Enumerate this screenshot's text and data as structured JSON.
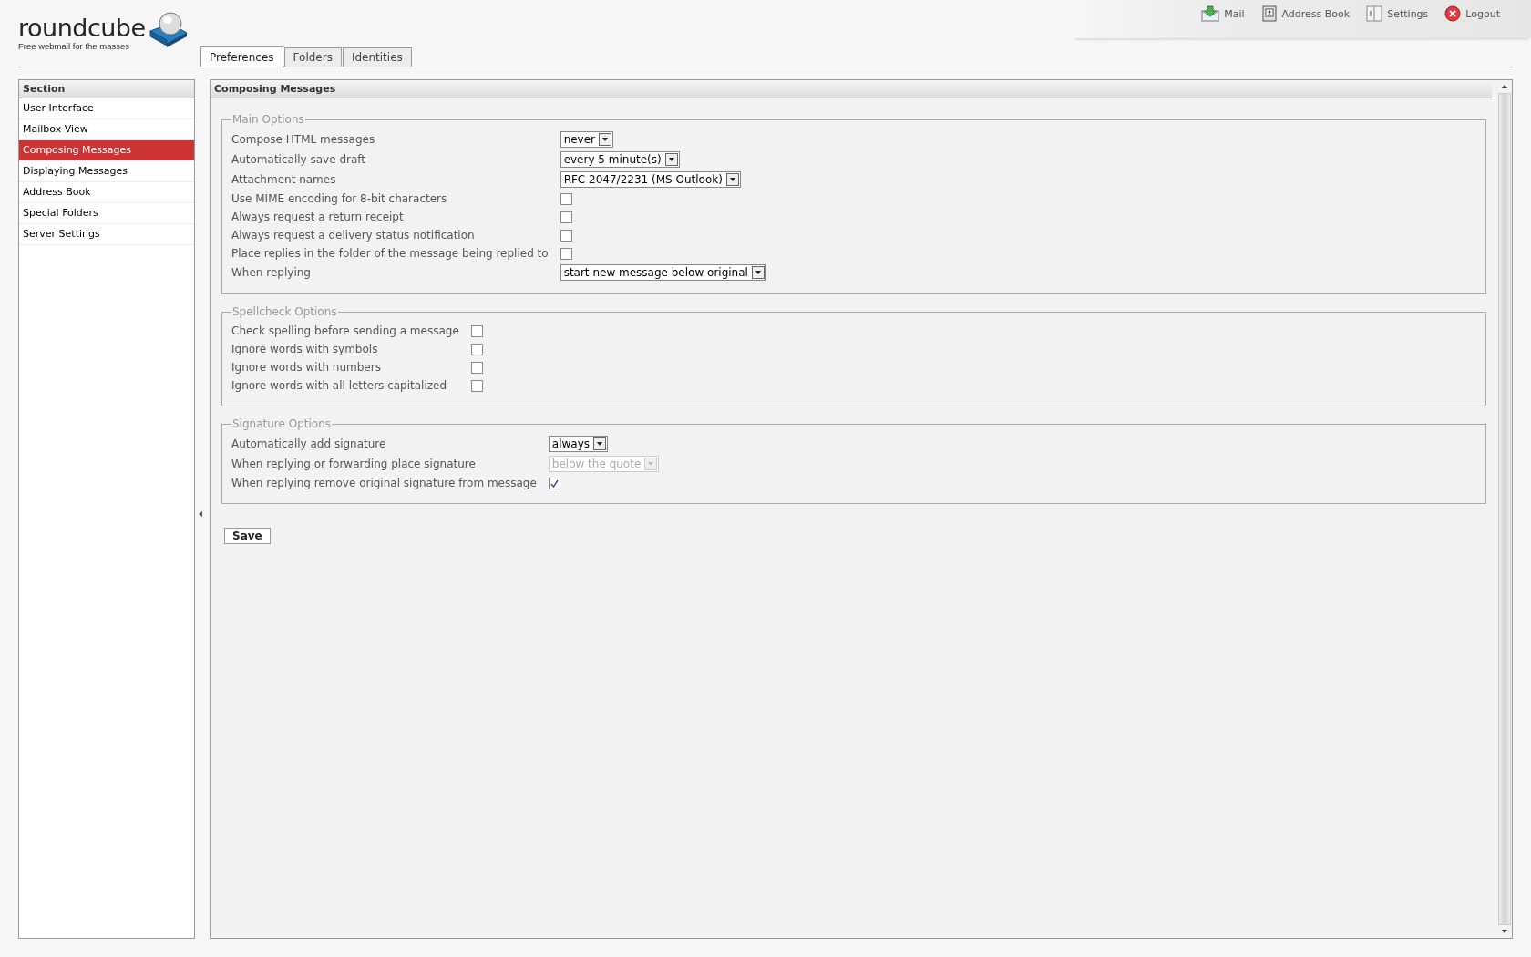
{
  "logo": {
    "name": "roundcube",
    "tagline": "Free webmail for the masses"
  },
  "top_nav": [
    {
      "label": "Mail",
      "kind": "mail"
    },
    {
      "label": "Address Book",
      "kind": "addressbook"
    },
    {
      "label": "Settings",
      "kind": "settings"
    },
    {
      "label": "Logout",
      "kind": "logout"
    }
  ],
  "tabs": [
    {
      "label": "Preferences",
      "selected": true
    },
    {
      "label": "Folders",
      "selected": false
    },
    {
      "label": "Identities",
      "selected": false
    }
  ],
  "sidebar": {
    "title": "Section",
    "items": [
      {
        "label": "User Interface",
        "selected": false
      },
      {
        "label": "Mailbox View",
        "selected": false
      },
      {
        "label": "Composing Messages",
        "selected": true
      },
      {
        "label": "Displaying Messages",
        "selected": false
      },
      {
        "label": "Address Book",
        "selected": false
      },
      {
        "label": "Special Folders",
        "selected": false
      },
      {
        "label": "Server Settings",
        "selected": false
      }
    ]
  },
  "panel": {
    "title": "Composing Messages",
    "fieldsets": [
      {
        "legend": "Main Options",
        "rows": [
          {
            "label": "Compose HTML messages",
            "kind": "select",
            "value": "never",
            "disabled": false
          },
          {
            "label": "Automatically save draft",
            "kind": "select",
            "value": "every 5 minute(s)",
            "disabled": false
          },
          {
            "label": "Attachment names",
            "kind": "select",
            "value": "RFC 2047/2231 (MS Outlook)",
            "disabled": false
          },
          {
            "label": "Use MIME encoding for 8-bit characters",
            "kind": "checkbox",
            "checked": false
          },
          {
            "label": "Always request a return receipt",
            "kind": "checkbox",
            "checked": false
          },
          {
            "label": "Always request a delivery status notification",
            "kind": "checkbox",
            "checked": false
          },
          {
            "label": "Place replies in the folder of the message being replied to",
            "kind": "checkbox",
            "checked": false
          },
          {
            "label": "When replying",
            "kind": "select",
            "value": "start new message below original",
            "disabled": false
          }
        ]
      },
      {
        "legend": "Spellcheck Options",
        "rows": [
          {
            "label": "Check spelling before sending a message",
            "kind": "checkbox",
            "checked": false
          },
          {
            "label": "Ignore words with symbols",
            "kind": "checkbox",
            "checked": false
          },
          {
            "label": "Ignore words with numbers",
            "kind": "checkbox",
            "checked": false
          },
          {
            "label": "Ignore words with all letters capitalized",
            "kind": "checkbox",
            "checked": false
          }
        ]
      },
      {
        "legend": "Signature Options",
        "rows": [
          {
            "label": "Automatically add signature",
            "kind": "select",
            "value": "always",
            "disabled": false
          },
          {
            "label": "When replying or forwarding place signature",
            "kind": "select",
            "value": "below the quote",
            "disabled": true
          },
          {
            "label": "When replying remove original signature from message",
            "kind": "checkbox",
            "checked": true
          }
        ]
      }
    ],
    "save_button": "Save"
  }
}
